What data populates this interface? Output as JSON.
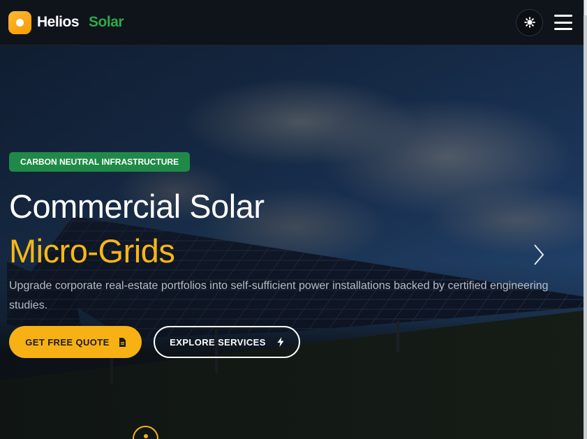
{
  "brand": {
    "name": "Helios",
    "accent": "Solar",
    "logo_icon": "sun-dot-logo-icon"
  },
  "header": {
    "theme_toggle_icon": "sun-gear-icon",
    "menu_icon": "hamburger-menu-icon"
  },
  "hero": {
    "badge": "CARBON NEUTRAL INFRASTRUCTURE",
    "title_line1": "Commercial Solar",
    "title_line2": "Micro-Grids",
    "description": "Upgrade corporate real-estate portfolios into self-sufficient power installations backed by certified engineering studies.",
    "primary_cta": {
      "label": "GET FREE QUOTE",
      "icon": "document-icon"
    },
    "secondary_cta": {
      "label": "EXPLORE SERVICES",
      "icon": "lightning-bolt-icon"
    },
    "next_slide_icon": "chevron-right-icon",
    "scroll_icon": "scroll-down-icon"
  },
  "colors": {
    "brand_accent": "#2fa84a",
    "primary": "#f7b114",
    "highlight_text": "#f7b715",
    "badge_bg": "#1f8a48",
    "header_bg": "#0f141b"
  }
}
